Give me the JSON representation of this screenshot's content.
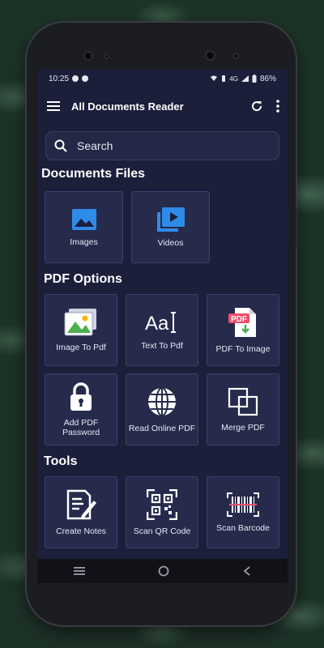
{
  "status": {
    "time": "10:25",
    "network": "4G",
    "battery": "86%"
  },
  "appbar": {
    "title": "All Documents Reader"
  },
  "search": {
    "placeholder": "Search"
  },
  "sections": {
    "documents": {
      "title": "Documents Files",
      "items": [
        {
          "label": "Images",
          "icon": "image-icon"
        },
        {
          "label": "Videos",
          "icon": "video-library-icon"
        }
      ]
    },
    "pdf": {
      "title": "PDF Options",
      "items": [
        {
          "label": "Image To Pdf",
          "icon": "gallery-icon"
        },
        {
          "label": "Text To Pdf",
          "icon": "text-aa-icon"
        },
        {
          "label": "PDF To Image",
          "icon": "pdf-file-icon"
        },
        {
          "label": "Add PDF Password",
          "icon": "lock-icon"
        },
        {
          "label": "Read Online PDF",
          "icon": "globe-icon"
        },
        {
          "label": "Merge PDF",
          "icon": "merge-icon"
        }
      ]
    },
    "tools": {
      "title": "Tools",
      "items": [
        {
          "label": "Create Notes",
          "icon": "notes-icon"
        },
        {
          "label": "Scan QR Code",
          "icon": "qr-code-icon"
        },
        {
          "label": "Scan Barcode",
          "icon": "barcode-icon"
        }
      ]
    }
  },
  "colors": {
    "screen_bg": "#1b1f3a",
    "card_bg": "#262b4c",
    "accent_blue": "#2f8be8",
    "pdf_red": "#ee4d6a"
  }
}
